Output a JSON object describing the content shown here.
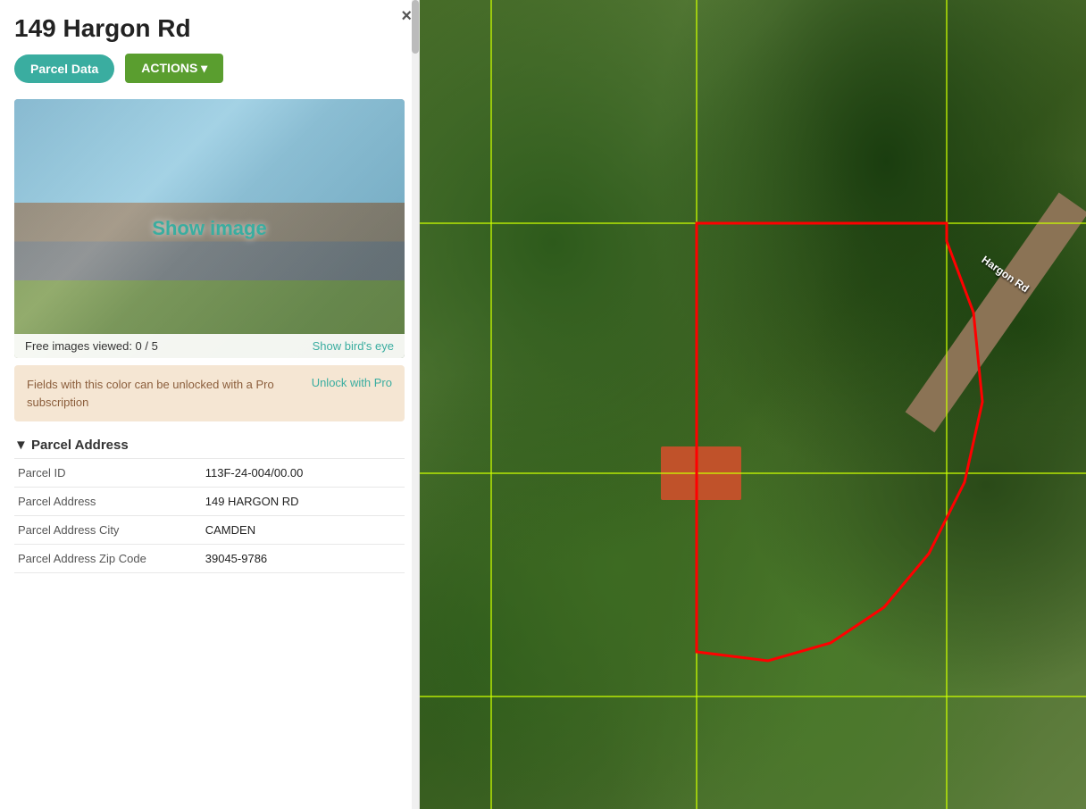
{
  "header": {
    "title": "149 Hargon Rd",
    "close_label": "×"
  },
  "toolbar": {
    "parcel_data_label": "Parcel Data",
    "actions_label": "ACTIONS ▾"
  },
  "image_section": {
    "show_image_label": "Show image",
    "free_images_label": "Free images viewed: 0 / 5",
    "birds_eye_label": "Show bird's eye"
  },
  "pro_notice": {
    "text": "Fields with this color can be unlocked with a Pro subscription",
    "unlock_label": "Unlock with Pro"
  },
  "parcel_address_section": {
    "header": "▼ Parcel Address",
    "rows": [
      {
        "label": "Parcel ID",
        "value": "113F-24-004/00.00"
      },
      {
        "label": "Parcel Address",
        "value": "149 HARGON RD"
      },
      {
        "label": "Parcel Address City",
        "value": "CAMDEN"
      },
      {
        "label": "Parcel Address Zip Code",
        "value": "39045-9786"
      }
    ]
  },
  "map": {
    "road_label": "Hargon Rd"
  },
  "colors": {
    "teal": "#3aada0",
    "green_btn": "#5a9e2f",
    "pro_bg": "#f5e6d3",
    "pro_text": "#8B5E3C"
  }
}
